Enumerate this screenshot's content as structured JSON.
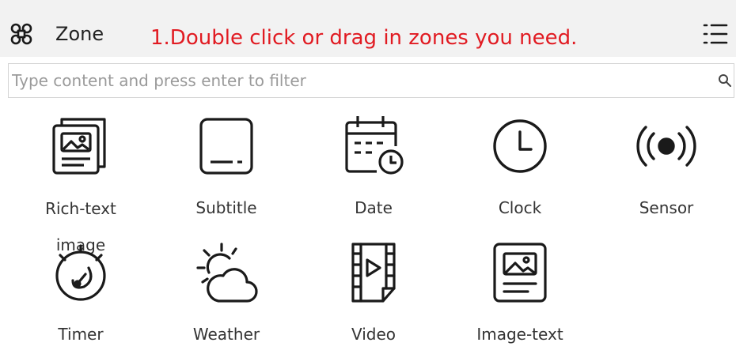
{
  "header": {
    "title": "Zone",
    "instruction": "1.Double click or drag in zones you need.",
    "zone_icon": "command-icon",
    "menu_icon": "list-menu-icon"
  },
  "search": {
    "placeholder": "Type content and press enter to filter",
    "value": "",
    "icon": "search-icon"
  },
  "zones": [
    {
      "label": "Rich-text image",
      "icon": "rich-text-image-icon"
    },
    {
      "label": "Subtitle",
      "icon": "subtitle-icon"
    },
    {
      "label": "Date",
      "icon": "date-icon"
    },
    {
      "label": "Clock",
      "icon": "clock-icon"
    },
    {
      "label": "Sensor",
      "icon": "sensor-icon"
    },
    {
      "label": "Timer",
      "icon": "timer-icon"
    },
    {
      "label": "Weather",
      "icon": "weather-icon"
    },
    {
      "label": "Video",
      "icon": "video-icon"
    },
    {
      "label": "Image-text",
      "icon": "image-text-icon"
    }
  ],
  "colors": {
    "instruction": "#e11b22",
    "header_bg": "#f2f2f2",
    "icon_stroke": "#1a1a1a"
  }
}
